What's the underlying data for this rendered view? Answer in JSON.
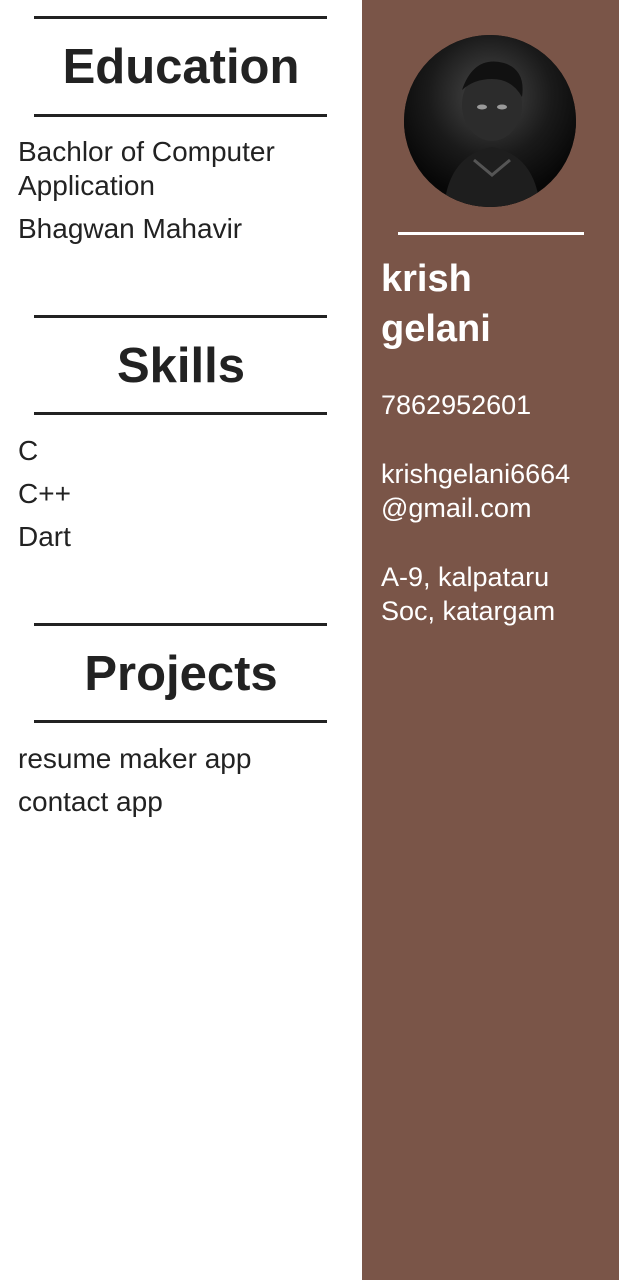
{
  "education": {
    "title": "Education",
    "degree_line1": "Bachlor of Computer",
    "degree_line2": "Application",
    "institute": "Bhagwan Mahavir"
  },
  "skills": {
    "title": "Skills",
    "items": [
      "C",
      "C++",
      "Dart"
    ]
  },
  "projects": {
    "title": "Projects",
    "items": [
      "resume maker app",
      "contact app"
    ]
  },
  "profile": {
    "first_name": "krish",
    "last_name": "gelani",
    "phone": "7862952601",
    "email_line1": "krishgelani6664",
    "email_line2": "@gmail.com",
    "address_line1": "A-9, kalpataru",
    "address_line2": "Soc, katargam"
  },
  "colors": {
    "sidebar": "#7a5548",
    "text": "#222222",
    "sidebar_text": "#ffffff"
  }
}
